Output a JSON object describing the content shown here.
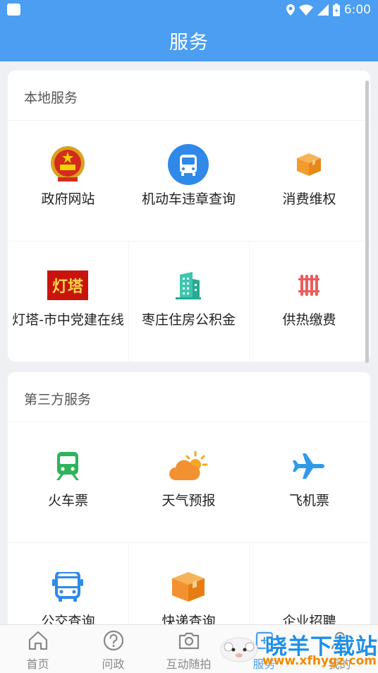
{
  "status_bar": {
    "time": "6:00"
  },
  "header": {
    "title": "服务"
  },
  "local_services": {
    "title": "本地服务",
    "items": [
      {
        "label": "政府网站",
        "icon": "national-emblem-icon"
      },
      {
        "label": "机动车违章查询",
        "icon": "bus-circle-icon"
      },
      {
        "label": "消费维权",
        "icon": "box-icon"
      },
      {
        "label": "灯塔-市中党建在线",
        "icon": "dengta-logo-icon",
        "logo_text": "灯塔"
      },
      {
        "label": "枣庄住房公积金",
        "icon": "buildings-icon"
      },
      {
        "label": "供热缴费",
        "icon": "radiator-icon"
      }
    ]
  },
  "third_party_services": {
    "title": "第三方服务",
    "items": [
      {
        "label": "火车票",
        "icon": "train-icon"
      },
      {
        "label": "天气预报",
        "icon": "weather-icon"
      },
      {
        "label": "飞机票",
        "icon": "airplane-icon"
      },
      {
        "label": "公交查询",
        "icon": "bus-icon"
      },
      {
        "label": "快递查询",
        "icon": "parcel-icon"
      },
      {
        "label": "企业招聘",
        "icon": "recruit-icon"
      }
    ]
  },
  "bottom_nav": {
    "items": [
      {
        "label": "首页",
        "icon": "home-icon"
      },
      {
        "label": "问政",
        "icon": "question-icon"
      },
      {
        "label": "互动随拍",
        "icon": "camera-icon"
      },
      {
        "label": "服务",
        "icon": "service-icon",
        "active": true
      },
      {
        "label": "我的",
        "icon": "user-icon"
      }
    ]
  },
  "watermark": {
    "brand": "晓羊下载站",
    "url": "www.xfhygz.com"
  },
  "colors": {
    "primary": "#4b9ef1",
    "background": "#eef0f3",
    "card": "#ffffff"
  }
}
